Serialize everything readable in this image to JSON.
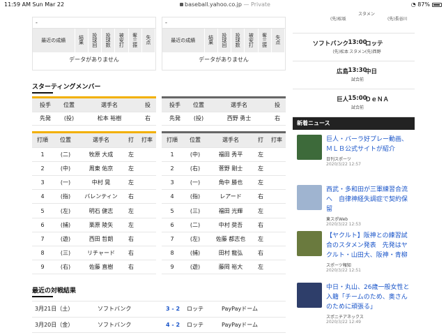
{
  "statusbar": {
    "time": "11:59 AM  Sun Mar 22",
    "url": "baseball.yahoo.co.jp",
    "private": " — Private",
    "battery": "87%"
  },
  "recent_left": {
    "dash": "-",
    "label": "最近の成績",
    "cols": [
      "結果",
      "投球回",
      "投球数",
      "被安打",
      "奪三振",
      "失点"
    ],
    "nodata": "データがありません"
  },
  "recent_right": {
    "dash": "-",
    "label": "最近の成績",
    "cols": [
      "結果",
      "投球回",
      "投球数",
      "被安打",
      "奪三振",
      "失点"
    ],
    "nodata": "データがありません"
  },
  "starting": {
    "title": "スターティングメンバー",
    "pitch_headers": [
      "投手",
      "位置",
      "選手名",
      "投"
    ],
    "order_headers": [
      "打順",
      "位置",
      "選手名",
      "打",
      "打率"
    ],
    "left_pitcher": [
      "先発",
      "(投)",
      "松本 裕樹",
      "右"
    ],
    "right_pitcher": [
      "先発",
      "(投)",
      "西野 勇士",
      "右"
    ],
    "left_order": [
      [
        "1",
        "(二)",
        "牧原 大成",
        "左",
        ""
      ],
      [
        "2",
        "(中)",
        "周東 佑京",
        "左",
        ""
      ],
      [
        "3",
        "(一)",
        "中村 晃",
        "左",
        ""
      ],
      [
        "4",
        "(指)",
        "バレンティン",
        "右",
        ""
      ],
      [
        "5",
        "(左)",
        "明石 健志",
        "左",
        ""
      ],
      [
        "6",
        "(捕)",
        "栗原 陵矢",
        "左",
        ""
      ],
      [
        "7",
        "(遊)",
        "西田 哲朗",
        "右",
        ""
      ],
      [
        "8",
        "(三)",
        "リチャード",
        "右",
        ""
      ],
      [
        "9",
        "(右)",
        "佐藤 直樹",
        "右",
        ""
      ]
    ],
    "right_order": [
      [
        "1",
        "(中)",
        "福田 秀平",
        "左",
        ""
      ],
      [
        "2",
        "(右)",
        "菅野 剛士",
        "左",
        ""
      ],
      [
        "3",
        "(一)",
        "角中 勝也",
        "左",
        ""
      ],
      [
        "4",
        "(指)",
        "レアード",
        "右",
        ""
      ],
      [
        "5",
        "(三)",
        "福田 光輝",
        "左",
        ""
      ],
      [
        "6",
        "(二)",
        "中村 奨吾",
        "右",
        ""
      ],
      [
        "7",
        "(左)",
        "佐藤 都志也",
        "左",
        ""
      ],
      [
        "8",
        "(捕)",
        "田村 龍弘",
        "右",
        ""
      ],
      [
        "9",
        "(遊)",
        "藤岡 裕大",
        "左",
        ""
      ]
    ]
  },
  "matches": {
    "title": "最近の対戦結果",
    "rows": [
      [
        "3月21日（土）",
        "ソフトバンク",
        "3 - 2",
        "ロッテ",
        "PayPayドーム"
      ],
      [
        "3月20日（金）",
        "ソフトバンク",
        "4 - 2",
        "ロッテ",
        "PayPayドーム"
      ]
    ]
  },
  "schedule": {
    "top_left_pitcher": "(先)松坂",
    "top_state": "スタメン",
    "top_right_pitcher": "(先)長谷川",
    "games": [
      {
        "home": "ソフトバンク",
        "time": "13:00",
        "away": "ロッテ",
        "state": "スタメン",
        "hp": "(先)松本",
        "ap": "(先)西野"
      },
      {
        "home": "広島",
        "time": "13:30",
        "away": "中日",
        "state": "試合前",
        "hp": "",
        "ap": ""
      },
      {
        "home": "巨人",
        "time": "15:00",
        "away": "ＤｅＮＡ",
        "state": "試合前",
        "hp": "",
        "ap": ""
      }
    ]
  },
  "news": {
    "title": "新着ニュース",
    "items": [
      {
        "title": "巨人・バーラ好プレー動画、ＭＬＢ公式サイトが紹介",
        "source": "日刊スポーツ",
        "date": "2020/3/22 12:57",
        "color": "#3d6a3a"
      },
      {
        "title": "西武・多和田が三軍練習合流へ　自律神経失調症で契約保留",
        "source": "東スポWeb",
        "date": "2020/3/22 12:53",
        "color": "#9fb4d0"
      },
      {
        "title": "【ヤクルト】阪神との練習試合のスタメン発表　先発はヤクルト・山田大、阪神・青柳",
        "source": "スポーツ報知",
        "date": "2020/3/22 12:51",
        "color": "#6a7a3e"
      },
      {
        "title": "中日・丸山、26歳一般女性と入籍「チームのため、奥さんのために頑張る」",
        "source": "スポニチアネックス",
        "date": "2020/3/22 12:49",
        "color": "#2e3e6a"
      }
    ]
  }
}
